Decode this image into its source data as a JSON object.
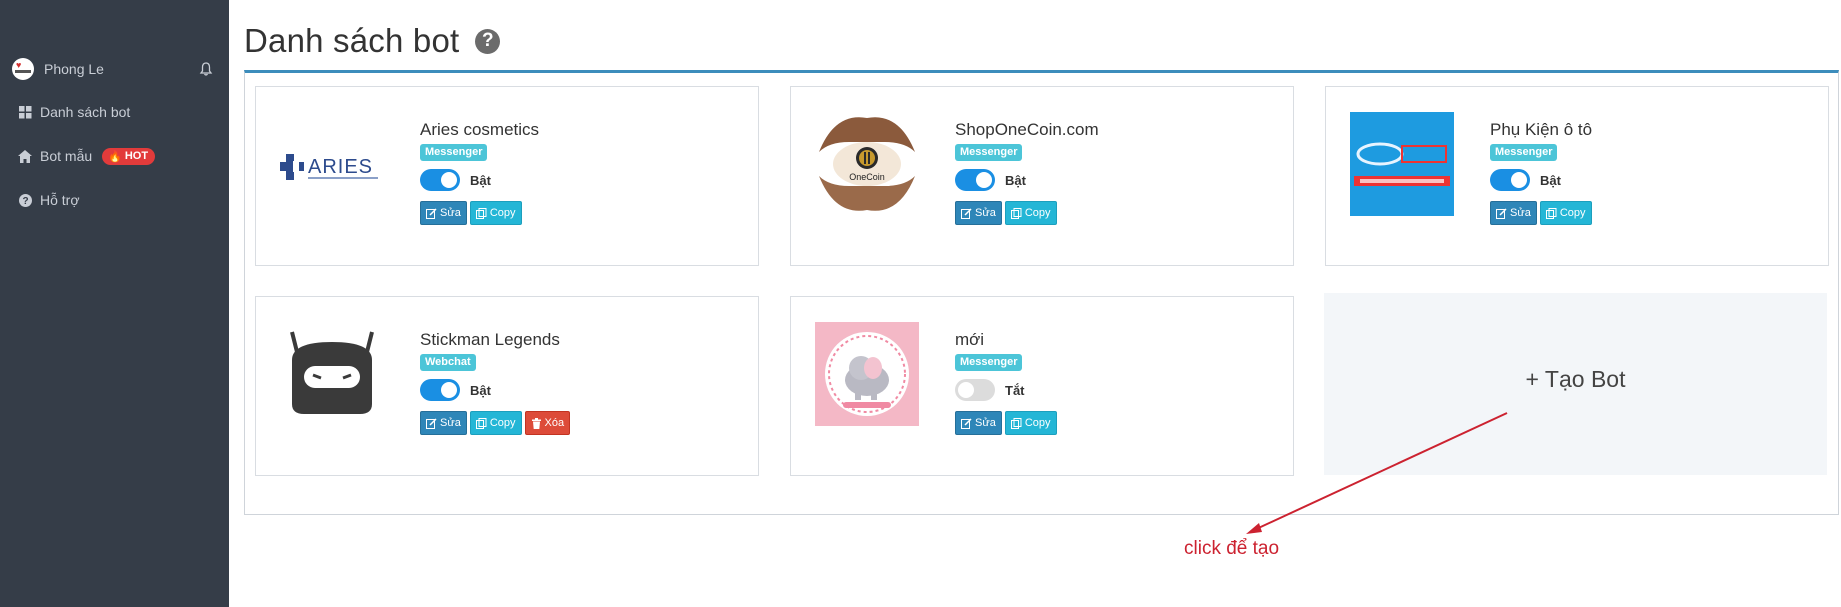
{
  "sidebar": {
    "user_name": "Phong Le",
    "items": [
      {
        "label": "Danh sách bot",
        "icon": "grid-icon"
      },
      {
        "label": "Bot mẫu",
        "icon": "rocket-icon",
        "badge": "HOT"
      },
      {
        "label": "Hỗ trợ",
        "icon": "question-circle-icon"
      }
    ]
  },
  "main": {
    "title": "Danh sách bot",
    "bots": [
      {
        "name": "Aries cosmetics",
        "type": "Messenger",
        "status": "Bật",
        "enabled": true,
        "logo": "aries-logo"
      },
      {
        "name": "ShopOneCoin.com",
        "type": "Messenger",
        "status": "Bật",
        "enabled": true,
        "logo": "onecoin-logo"
      },
      {
        "name": "Phụ Kiện ô tô",
        "type": "Messenger",
        "status": "Bật",
        "enabled": true,
        "logo": "phukienoto-logo"
      },
      {
        "name": "Stickman Legends",
        "type": "Webchat",
        "status": "Bật",
        "enabled": true,
        "logo": "stickman-robot-logo"
      },
      {
        "name": "mới",
        "type": "Messenger",
        "status": "Tắt",
        "enabled": false,
        "logo": "baby-elephant-logo"
      }
    ],
    "buttons": {
      "edit": "Sửa",
      "copy": "Copy",
      "delete": "Xóa"
    },
    "create_bot_label": "+ Tạo Bot",
    "annotation": "click để tạo",
    "logo_texts": {
      "aries": "ARIES",
      "onecoin": "OneCoin"
    }
  },
  "colors": {
    "sidebar_bg": "#353d48",
    "accent": "#3c8dbc",
    "toggle_on": "#1a8fe3",
    "badge": "#4cc5d8",
    "hot": "#e23b3b",
    "annotation": "#cc2230"
  }
}
